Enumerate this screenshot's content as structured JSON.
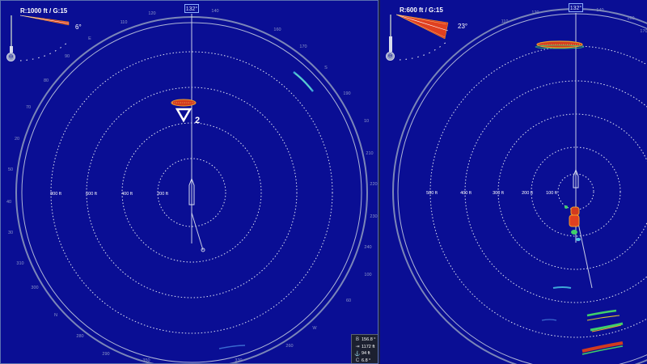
{
  "colors": {
    "background": "#0a0e94",
    "ring": "#c8cde6",
    "target_red": "#d23a1f",
    "target_orange": "#f0a02a",
    "target_green": "#3fd06a",
    "target_cyan": "#4fc3e8"
  },
  "left_panel": {
    "range_gain": "R:1000 ft / G:15",
    "tilt": "6°",
    "heading": "132°",
    "tilt_fraction": 0.25,
    "range_labels": [
      "800 ft",
      "600 ft",
      "400 ft",
      "200 ft"
    ],
    "bearing_labels": [
      "120",
      "140",
      "110",
      "160",
      "170",
      "S",
      "190",
      "210",
      "220",
      "230",
      "240",
      "W",
      "260",
      "280",
      "290",
      "300",
      "310",
      "N",
      "70",
      "80",
      "90",
      "E",
      "50",
      "40",
      "30",
      "20",
      "10",
      "100",
      "60",
      "330",
      "350"
    ],
    "target_marker": "2",
    "info": {
      "bearing_icon": "bearing-icon",
      "bearing": "156.8 °",
      "distance_icon": "distance-icon",
      "distance": "1172 ft",
      "depth_icon": "anchor-icon",
      "depth": "94 ft",
      "course_icon": "course-icon",
      "course": "6.8 °"
    }
  },
  "right_panel": {
    "range_gain": "R:600 ft / G:15",
    "tilt": "23°",
    "heading": "132°",
    "tilt_fraction": 0.6,
    "range_labels": [
      "500 ft",
      "400 ft",
      "300 ft",
      "200 ft",
      "100 ft"
    ],
    "bearing_labels": [
      "120",
      "140",
      "110",
      "160",
      "170"
    ]
  }
}
